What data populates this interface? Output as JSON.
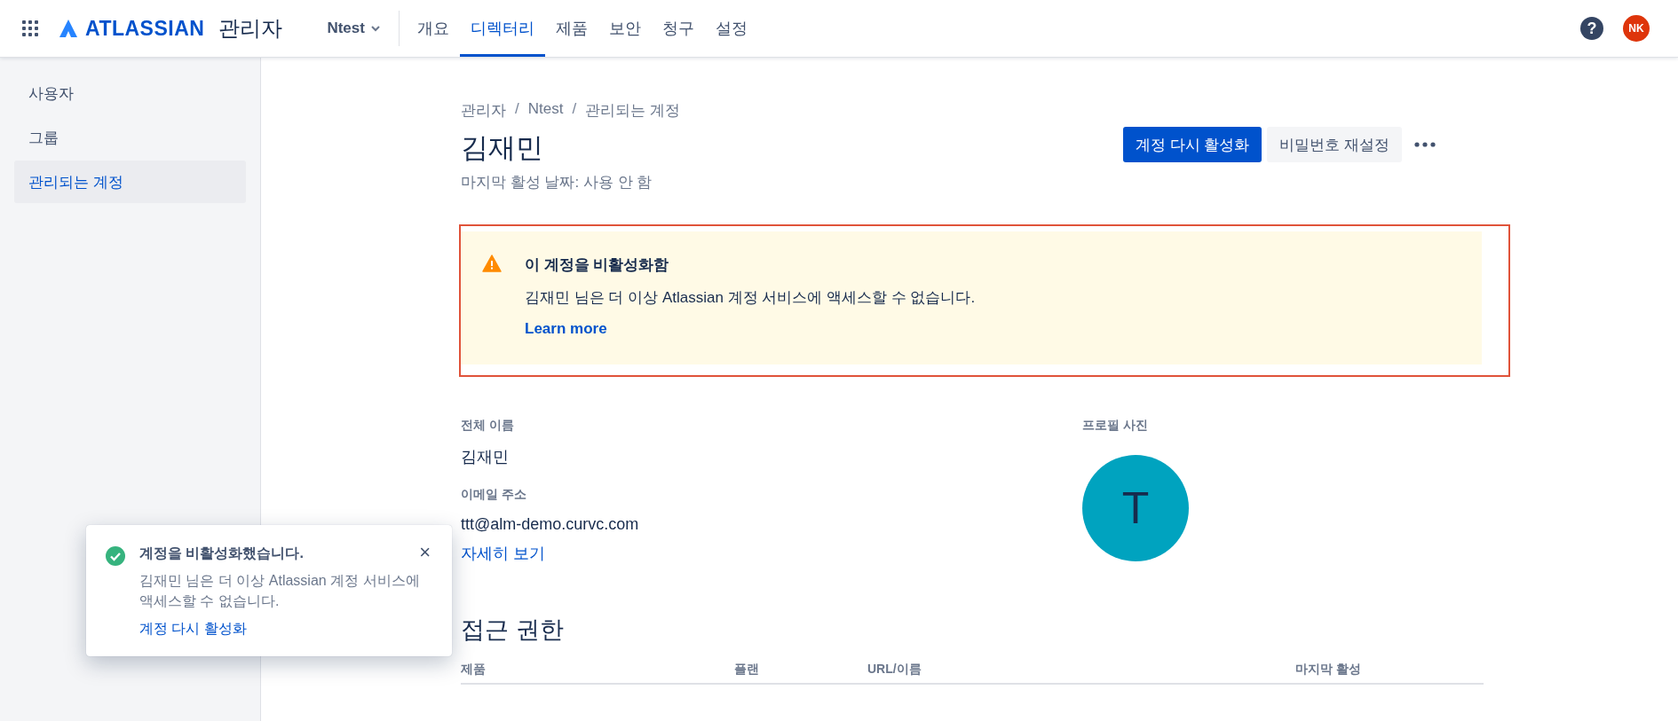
{
  "nav": {
    "logo": "ATLASSIAN",
    "product": "관리자",
    "org": "Ntest",
    "tabs": [
      {
        "label": "개요",
        "selected": false
      },
      {
        "label": "디렉터리",
        "selected": true
      },
      {
        "label": "제품",
        "selected": false
      },
      {
        "label": "보안",
        "selected": false
      },
      {
        "label": "청구",
        "selected": false
      },
      {
        "label": "설정",
        "selected": false
      }
    ],
    "help": "?",
    "avatar": "NK"
  },
  "sidebar": {
    "items": [
      {
        "label": "사용자",
        "selected": false
      },
      {
        "label": "그룹",
        "selected": false
      },
      {
        "label": "관리되는 계정",
        "selected": true
      }
    ]
  },
  "breadcrumbs": [
    {
      "kind": "link",
      "text": "관리자"
    },
    {
      "kind": "separator",
      "text": "/"
    },
    {
      "kind": "link",
      "text": "Ntest"
    },
    {
      "kind": "separator",
      "text": "/"
    },
    {
      "kind": "link",
      "text": "관리되는 계정"
    }
  ],
  "title": "김재민",
  "subtitle": "마지막 활성 날짜: 사용 안 함",
  "actions": [
    {
      "kind": "primary",
      "label": "계정 다시 활성화"
    },
    {
      "kind": "default",
      "label": "비밀번호 재설정"
    },
    {
      "kind": "more"
    }
  ],
  "banner": {
    "title": "이 계정을 비활성화함",
    "message": "김재민 님은 더 이상 Atlassian 계정 서비스에 액세스할 수 없습니다.",
    "link": "Learn more",
    "highlighted": true
  },
  "details": [
    {
      "label": "전체 이름",
      "value": "김재민"
    },
    {
      "label": "이메일 주소",
      "value": "ttt@alm-demo.curvc.com",
      "link": "자세히 보기"
    }
  ],
  "profile": {
    "label": "프로필 사진",
    "initial": "T"
  },
  "access": {
    "heading": "접근 권한",
    "columns": [
      "제품",
      "플랜",
      "URL/이름",
      "마지막 활성"
    ]
  },
  "toast": {
    "title": "계정을 비활성화했습니다.",
    "message": "김재민 님은 더 이상 Atlassian 계정 서비스에 액세스할 수 없습니다.",
    "action": "계정 다시 활성화",
    "close": "×"
  }
}
